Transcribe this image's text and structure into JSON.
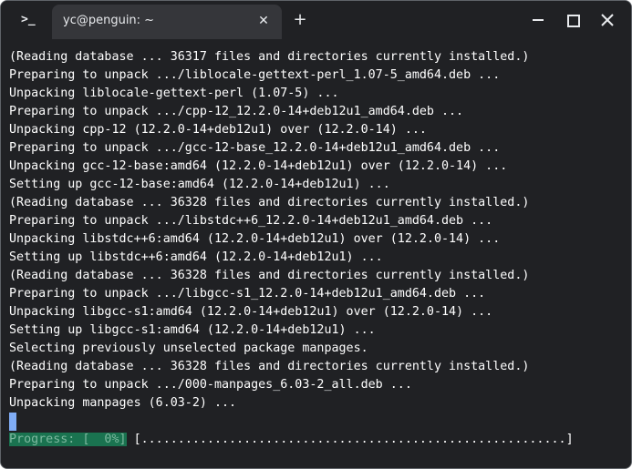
{
  "titlebar": {
    "app_icon_text": ">_",
    "tab_title": "yc@penguin: ~",
    "tab_close": "✕",
    "new_tab": "+"
  },
  "terminal": {
    "lines": [
      "(Reading database ... 36317 files and directories currently installed.)",
      "Preparing to unpack .../liblocale-gettext-perl_1.07-5_amd64.deb ...",
      "Unpacking liblocale-gettext-perl (1.07-5) ...",
      "Preparing to unpack .../cpp-12_12.2.0-14+deb12u1_amd64.deb ...",
      "Unpacking cpp-12 (12.2.0-14+deb12u1) over (12.2.0-14) ...",
      "Preparing to unpack .../gcc-12-base_12.2.0-14+deb12u1_amd64.deb ...",
      "Unpacking gcc-12-base:amd64 (12.2.0-14+deb12u1) over (12.2.0-14) ...",
      "Setting up gcc-12-base:amd64 (12.2.0-14+deb12u1) ...",
      "(Reading database ... 36328 files and directories currently installed.)",
      "Preparing to unpack .../libstdc++6_12.2.0-14+deb12u1_amd64.deb ...",
      "Unpacking libstdc++6:amd64 (12.2.0-14+deb12u1) over (12.2.0-14) ...",
      "Setting up libstdc++6:amd64 (12.2.0-14+deb12u1) ...",
      "(Reading database ... 36328 files and directories currently installed.)",
      "Preparing to unpack .../libgcc-s1_12.2.0-14+deb12u1_amd64.deb ...",
      "Unpacking libgcc-s1:amd64 (12.2.0-14+deb12u1) over (12.2.0-14) ...",
      "Setting up libgcc-s1:amd64 (12.2.0-14+deb12u1) ...",
      "Selecting previously unselected package manpages.",
      "(Reading database ... 36328 files and directories currently installed.)",
      "Preparing to unpack .../000-manpages_6.03-2_all.deb ...",
      "Unpacking manpages (6.03-2) ..."
    ],
    "progress_label": "Progress: [  0%]",
    "progress_bar": " [..........................................................]"
  },
  "colors": {
    "background": "#202124",
    "text": "#ffffff",
    "cursor": "#7facf5",
    "progress_bg": "#1a7350",
    "progress_text": "#7db89f"
  },
  "icons": {
    "app": "terminal-icon",
    "close_tab": "close-icon",
    "new_tab": "plus-icon",
    "minimize": "minimize-icon",
    "maximize": "maximize-icon",
    "close_window": "close-icon"
  }
}
